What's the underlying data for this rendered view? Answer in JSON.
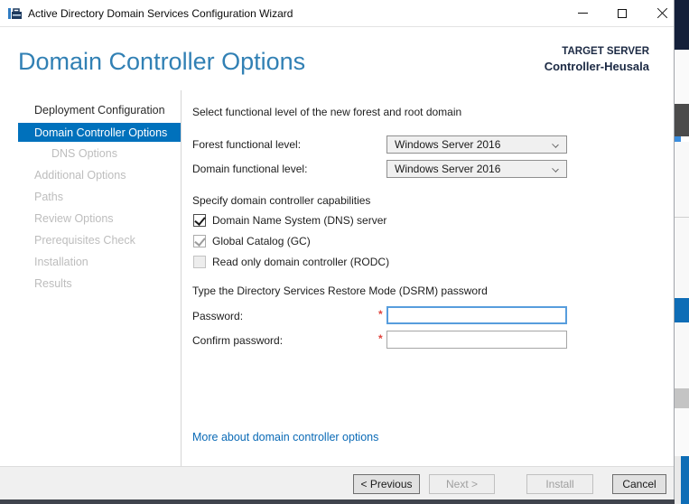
{
  "window": {
    "title": "Active Directory Domain Services Configuration Wizard",
    "icon": "adds-wizard-icon",
    "controls": [
      "minimize-icon",
      "maximize-icon",
      "close-icon"
    ]
  },
  "header": {
    "title": "Domain Controller Options",
    "target_server_label": "TARGET SERVER",
    "target_server_name": "Controller-Heusala"
  },
  "sidebar": {
    "items": [
      {
        "label": "Deployment Configuration",
        "state": "enabled"
      },
      {
        "label": "Domain Controller Options",
        "state": "selected"
      },
      {
        "label": "DNS Options",
        "state": "disabled",
        "indent": true
      },
      {
        "label": "Additional Options",
        "state": "disabled"
      },
      {
        "label": "Paths",
        "state": "disabled"
      },
      {
        "label": "Review Options",
        "state": "disabled"
      },
      {
        "label": "Prerequisites Check",
        "state": "disabled"
      },
      {
        "label": "Installation",
        "state": "disabled"
      },
      {
        "label": "Results",
        "state": "disabled"
      }
    ]
  },
  "content": {
    "functional_level_heading": "Select functional level of the new forest and root domain",
    "forest_label": "Forest functional level:",
    "forest_value": "Windows Server 2016",
    "domain_label": "Domain functional level:",
    "domain_value": "Windows Server 2016",
    "capabilities_heading": "Specify domain controller capabilities",
    "checkboxes": [
      {
        "label": "Domain Name System (DNS) server",
        "checked": true,
        "enabled": true
      },
      {
        "label": "Global Catalog (GC)",
        "checked": true,
        "enabled": false
      },
      {
        "label": "Read only domain controller (RODC)",
        "checked": false,
        "enabled": false
      }
    ],
    "dsrm_heading": "Type the Directory Services Restore Mode (DSRM) password",
    "password_label": "Password:",
    "confirm_label": "Confirm password:",
    "required_marker": "*",
    "password_value": "",
    "confirm_value": "",
    "more_link": "More about domain controller options"
  },
  "footer": {
    "previous": "< Previous",
    "next": "Next >",
    "install": "Install",
    "cancel": "Cancel"
  },
  "colors": {
    "nav_selected_blue": "#0071bc",
    "title_blue": "#3180b4",
    "link_blue": "#0a6ab6",
    "required_red": "#e0433c",
    "focused_input_blue": "#579ddd",
    "target_server_navy": "#1c2a44"
  }
}
